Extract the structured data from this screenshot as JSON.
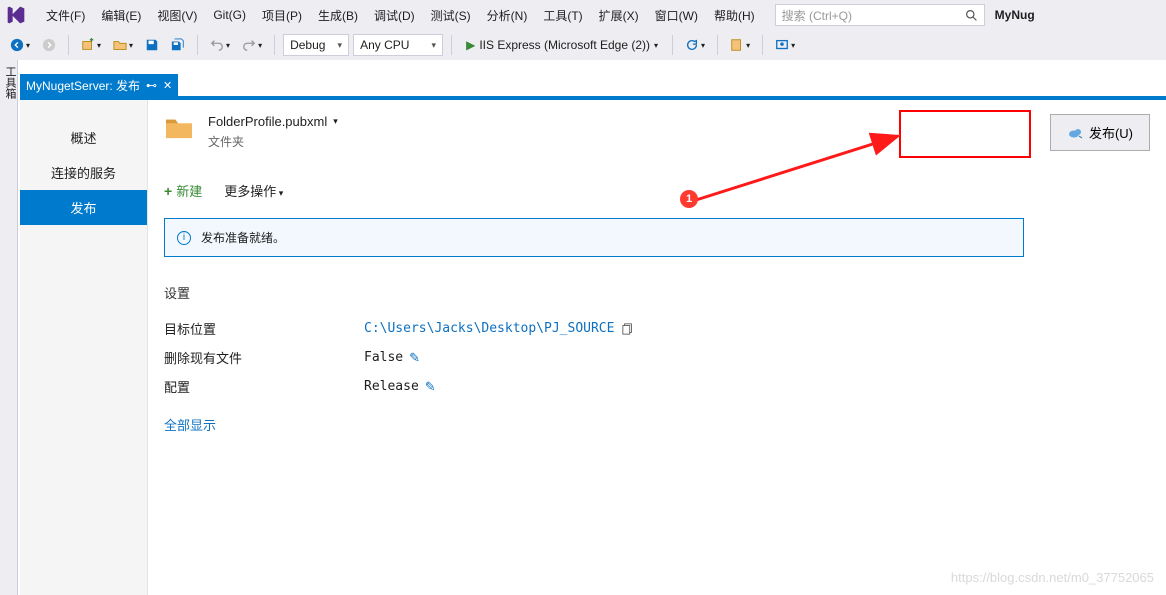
{
  "menu": {
    "file": "文件(F)",
    "edit": "编辑(E)",
    "view": "视图(V)",
    "git": "Git(G)",
    "project": "项目(P)",
    "build": "生成(B)",
    "debug": "调试(D)",
    "test": "测试(S)",
    "analyze": "分析(N)",
    "tools": "工具(T)",
    "extensions": "扩展(X)",
    "window": "窗口(W)",
    "help": "帮助(H)"
  },
  "search": {
    "placeholder": "搜索 (Ctrl+Q)"
  },
  "solution_name": "MyNug",
  "toolbar": {
    "config": "Debug",
    "platform": "Any CPU",
    "run_target": "IIS Express (Microsoft Edge (2))"
  },
  "vtab": {
    "toolbox": "工具箱"
  },
  "doc_tab": {
    "title": "MyNugetServer: 发布"
  },
  "sidebar": {
    "items": [
      {
        "label": "概述"
      },
      {
        "label": "连接的服务"
      },
      {
        "label": "发布"
      }
    ],
    "selected_index": 2
  },
  "profile": {
    "file": "FolderProfile.pubxml",
    "type": "文件夹"
  },
  "publish_button": "发布(U)",
  "actions": {
    "new": "新建",
    "more": "更多操作"
  },
  "status": {
    "message": "发布准备就绪。"
  },
  "settings": {
    "title": "设置",
    "rows": [
      {
        "label": "目标位置",
        "value": "C:\\Users\\Jacks\\Desktop\\PJ_SOURCE",
        "is_link": true,
        "copy": true
      },
      {
        "label": "删除现有文件",
        "value": "False",
        "editable": true
      },
      {
        "label": "配置",
        "value": "Release",
        "editable": true
      }
    ],
    "show_all": "全部显示"
  },
  "annotation": {
    "num": "1"
  },
  "watermark": "https://blog.csdn.net/m0_37752065"
}
